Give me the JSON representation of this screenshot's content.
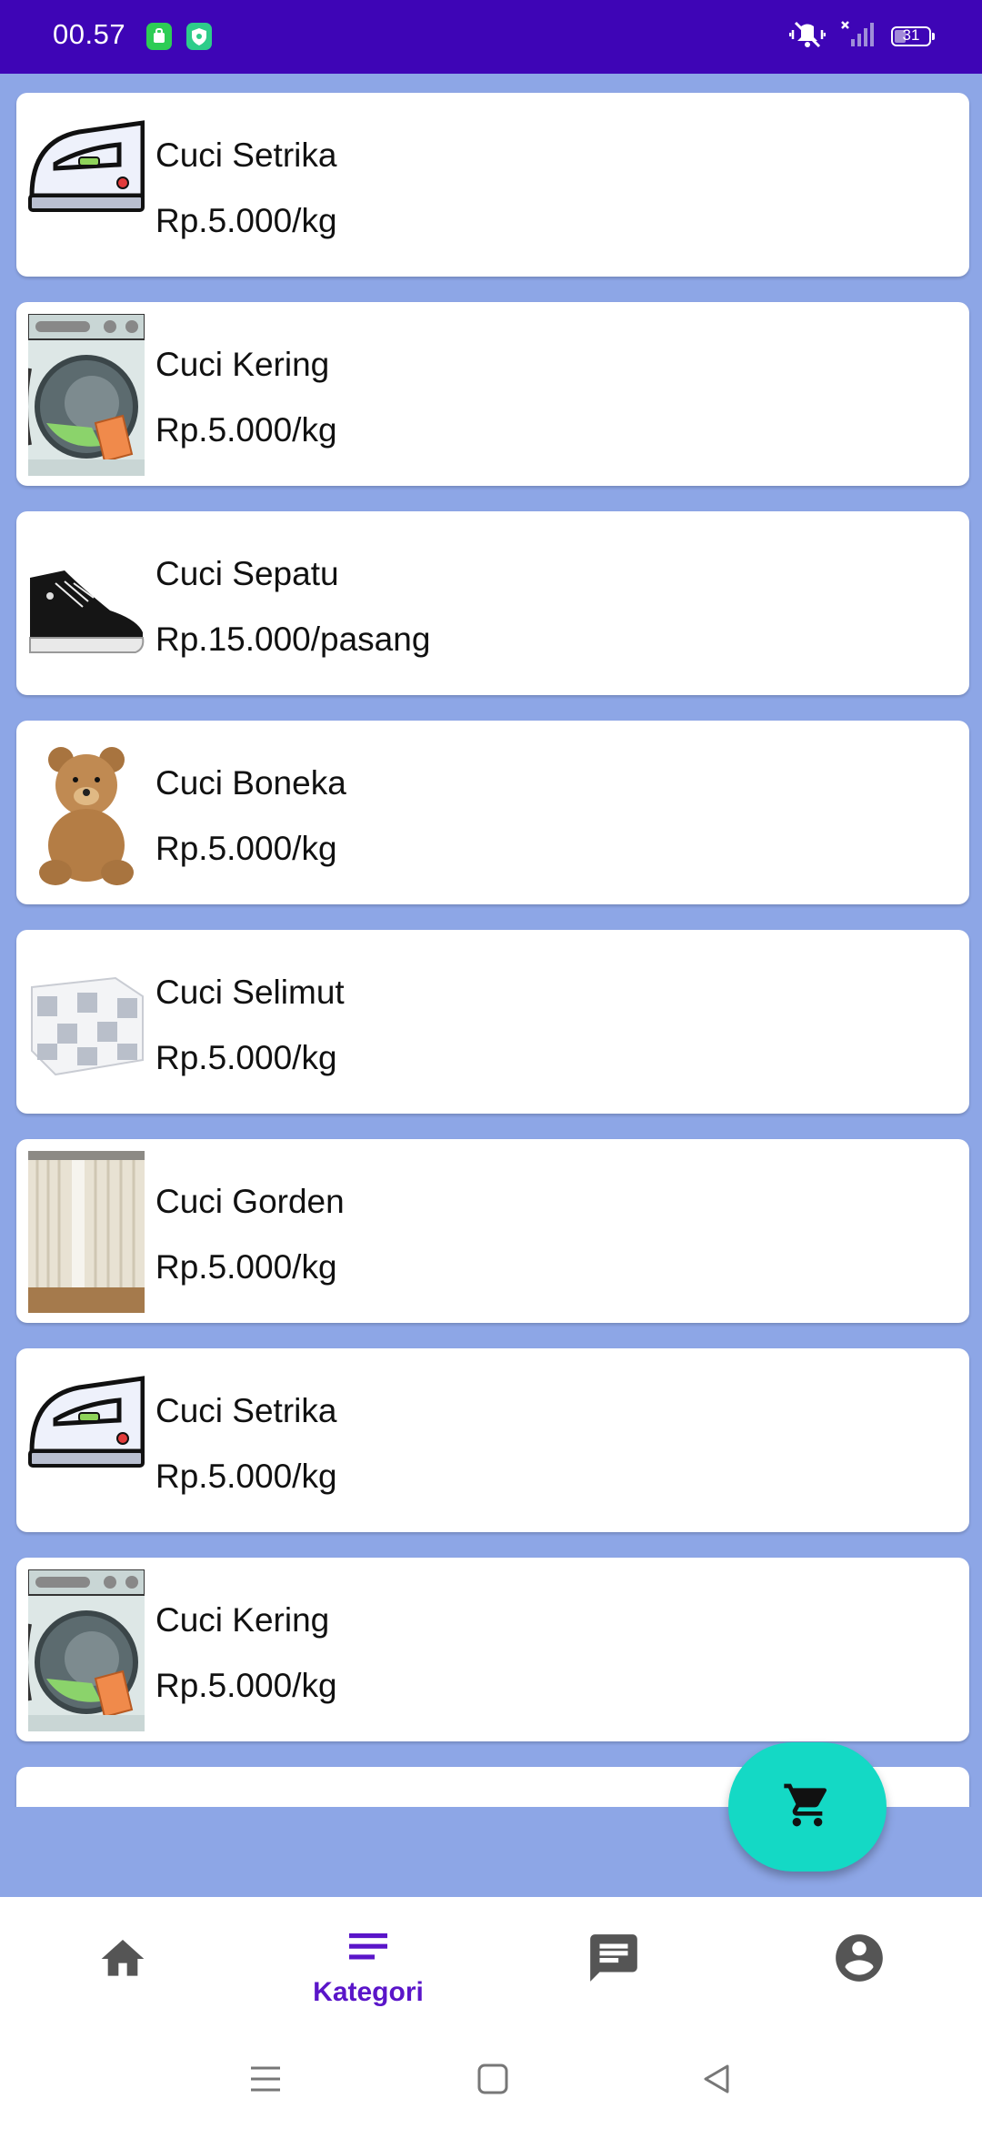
{
  "status_bar": {
    "time": "00.57",
    "battery": "31",
    "battery_level": 0.31
  },
  "colors": {
    "status_bar": "#3e05b6",
    "background": "#8da6e6",
    "fab": "#14d9c5",
    "nav_active": "#5a15c9",
    "nav_inactive": "#555555"
  },
  "items": [
    {
      "title": "Cuci Setrika",
      "price": "Rp.5.000/kg",
      "image": "iron-image"
    },
    {
      "title": "Cuci Kering",
      "price": "Rp.5.000/kg",
      "image": "washing-machine-image"
    },
    {
      "title": "Cuci Sepatu",
      "price": "Rp.15.000/pasang",
      "image": "sneaker-image"
    },
    {
      "title": "Cuci Boneka",
      "price": "Rp.5.000/kg",
      "image": "teddy-bear-image"
    },
    {
      "title": "Cuci Selimut",
      "price": "Rp.5.000/kg",
      "image": "blanket-image"
    },
    {
      "title": "Cuci Gorden",
      "price": "Rp.5.000/kg",
      "image": "curtain-image"
    },
    {
      "title": "Cuci Setrika",
      "price": "Rp.5.000/kg",
      "image": "iron-image"
    },
    {
      "title": "Cuci Kering",
      "price": "Rp.5.000/kg",
      "image": "washing-machine-image"
    }
  ],
  "fab": {
    "icon": "cart-icon"
  },
  "bottom_nav": {
    "home": {
      "icon": "home-icon"
    },
    "kategori": {
      "icon": "category-icon",
      "label": "Kategori",
      "active": true
    },
    "chat": {
      "icon": "chat-icon"
    },
    "profile": {
      "icon": "account-icon"
    }
  },
  "system_nav": {
    "menu": "menu-icon",
    "home": "square-icon",
    "back": "back-icon"
  }
}
